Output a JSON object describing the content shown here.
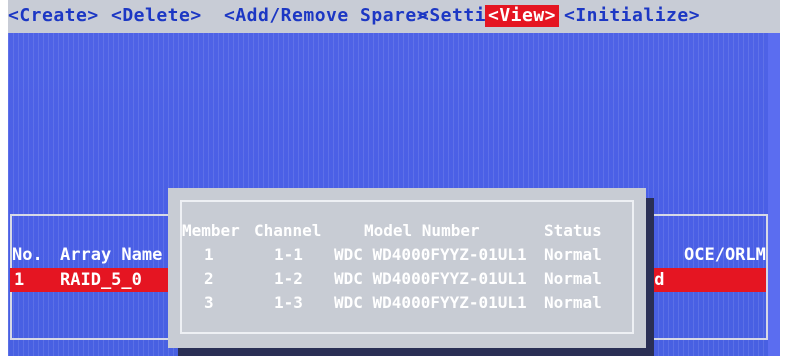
{
  "menu": {
    "items": [
      {
        "label": "<Create>"
      },
      {
        "label": "<Delete>"
      },
      {
        "label": "<Add/Remove Spare>"
      },
      {
        "label": "<Settings>"
      },
      {
        "label": "<View>",
        "active": true
      },
      {
        "label": "<Initialize>"
      }
    ]
  },
  "array_list": {
    "headers": {
      "no": "No.",
      "name": "Array Name",
      "oce": "OCE/ORLM"
    },
    "rows": [
      {
        "no": "1",
        "name": "RAID_5_0",
        "status_fragment": "ed",
        "selected": true
      }
    ]
  },
  "member_popup": {
    "headers": {
      "member": "Member",
      "channel": "Channel",
      "model": "Model Number",
      "status": "Status"
    },
    "rows": [
      {
        "member": "1",
        "channel": "1-1",
        "model": "WDC WD4000FYYZ-01UL1",
        "status": "Normal"
      },
      {
        "member": "2",
        "channel": "1-2",
        "model": "WDC WD4000FYYZ-01UL1",
        "status": "Normal"
      },
      {
        "member": "3",
        "channel": "1-3",
        "model": "WDC WD4000FYYZ-01UL1",
        "status": "Normal"
      }
    ]
  },
  "colors": {
    "background_blue": "#4f63e6",
    "menu_text": "#1c37c4",
    "highlight_red": "#e51522",
    "popup_gray": "#c8ccd4"
  }
}
